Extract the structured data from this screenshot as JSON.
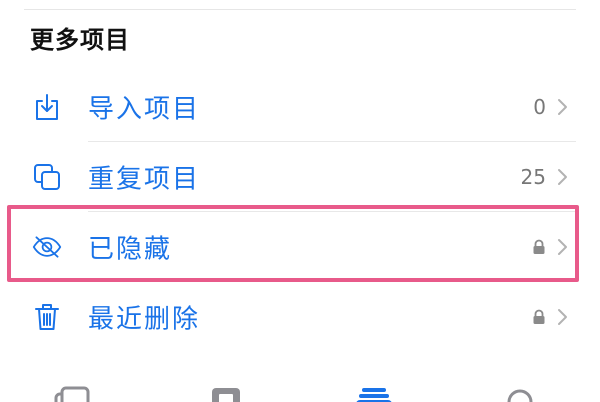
{
  "section": {
    "title": "更多项目"
  },
  "items": [
    {
      "label": "导入项目",
      "count": "0",
      "icon": "import-icon",
      "locked": false
    },
    {
      "label": "重复项目",
      "count": "25",
      "icon": "duplicate-icon",
      "locked": false
    },
    {
      "label": "已隐藏",
      "count": "",
      "icon": "eye-slash-icon",
      "locked": true
    },
    {
      "label": "最近删除",
      "count": "",
      "icon": "trash-icon",
      "locked": true
    }
  ],
  "colors": {
    "accent": "#1a73e8",
    "highlight": "#e85a8a"
  },
  "tabbar": {
    "icons": [
      "library-icon",
      "for-you-icon",
      "albums-icon",
      "search-icon"
    ]
  }
}
